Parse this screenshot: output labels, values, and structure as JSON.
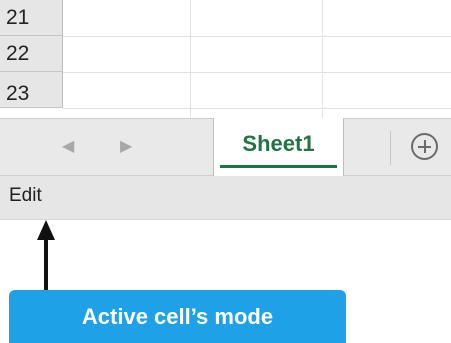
{
  "grid": {
    "rows": [
      "21",
      "22",
      "23"
    ]
  },
  "sheet_tabs": {
    "prev_icon": "chevron-left-icon",
    "next_icon": "chevron-right-icon",
    "prev_glyph": "◀",
    "next_glyph": "▶",
    "tabs": [
      {
        "label": "Sheet1",
        "active": true
      }
    ],
    "add_icon": "plus-circle-icon",
    "accent_color": "#217346"
  },
  "status_bar": {
    "mode": "Edit"
  },
  "annotation": {
    "label": "Active cell’s mode",
    "color": "#1ea1e6"
  }
}
